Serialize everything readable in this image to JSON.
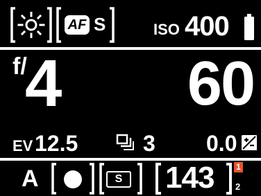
{
  "top_bar": {
    "white_balance_icon": "sun-icon",
    "af_badge": "AF",
    "af_mode": "S",
    "iso_label": "ISO",
    "iso_value": "400",
    "battery_icon": "battery-icon"
  },
  "main": {
    "aperture_prefix": "f/",
    "aperture_value": "4",
    "shutter_speed": "60"
  },
  "info": {
    "ev_label": "EV",
    "ev_value": "12.5",
    "drive_icon": "continuous-shooting-icon",
    "burst_count": "3",
    "exposure_comp": "0.0",
    "exposure_comp_icon": "exposure-compensation-icon"
  },
  "bottom_bar": {
    "mode": "A",
    "metering_icon": "metering-dot-icon",
    "quality_badge": "S",
    "shots_remaining": "143",
    "card_slot_active": "1",
    "card_slot_secondary": "2",
    "accent_color": "#e8532a"
  }
}
